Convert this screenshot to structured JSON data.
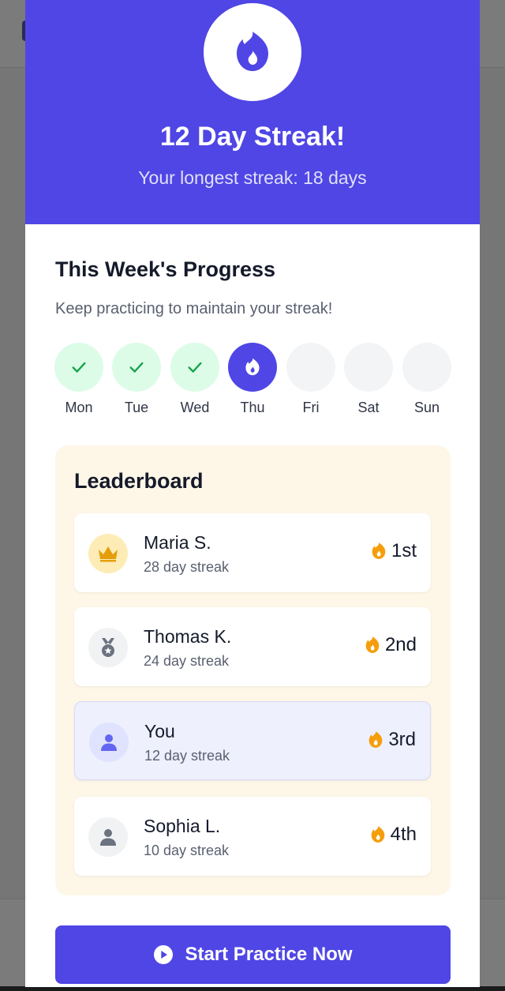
{
  "colors": {
    "accent": "#4f46e5",
    "success": "#16a34a",
    "success_bg": "#dcfce7",
    "flame": "#f59e0b",
    "leaderboard_bg": "#fef7e8"
  },
  "header": {
    "icon": "flame-icon",
    "title": "12 Day Streak!",
    "subtitle": "Your longest streak: 18 days"
  },
  "week": {
    "title": "This Week's Progress",
    "subtitle": "Keep practicing to maintain your streak!",
    "days": [
      {
        "label": "Mon",
        "state": "done",
        "icon": "check-icon"
      },
      {
        "label": "Tue",
        "state": "done",
        "icon": "check-icon"
      },
      {
        "label": "Wed",
        "state": "done",
        "icon": "check-icon"
      },
      {
        "label": "Thu",
        "state": "today",
        "icon": "flame-icon"
      },
      {
        "label": "Fri",
        "state": "future"
      },
      {
        "label": "Sat",
        "state": "future"
      },
      {
        "label": "Sun",
        "state": "future"
      }
    ]
  },
  "leaderboard": {
    "title": "Leaderboard",
    "rows": [
      {
        "name": "Maria S.",
        "streak": "28 day streak",
        "rank": "1st",
        "icon": "crown-icon"
      },
      {
        "name": "Thomas K.",
        "streak": "24 day streak",
        "rank": "2nd",
        "icon": "medal-icon"
      },
      {
        "name": "You",
        "streak": "12 day streak",
        "rank": "3rd",
        "icon": "user-icon",
        "is_me": true
      },
      {
        "name": "Sophia L.",
        "streak": "10 day streak",
        "rank": "4th",
        "icon": "user-icon"
      }
    ]
  },
  "cta": {
    "label": "Start Practice Now",
    "icon": "play-circle-icon"
  }
}
